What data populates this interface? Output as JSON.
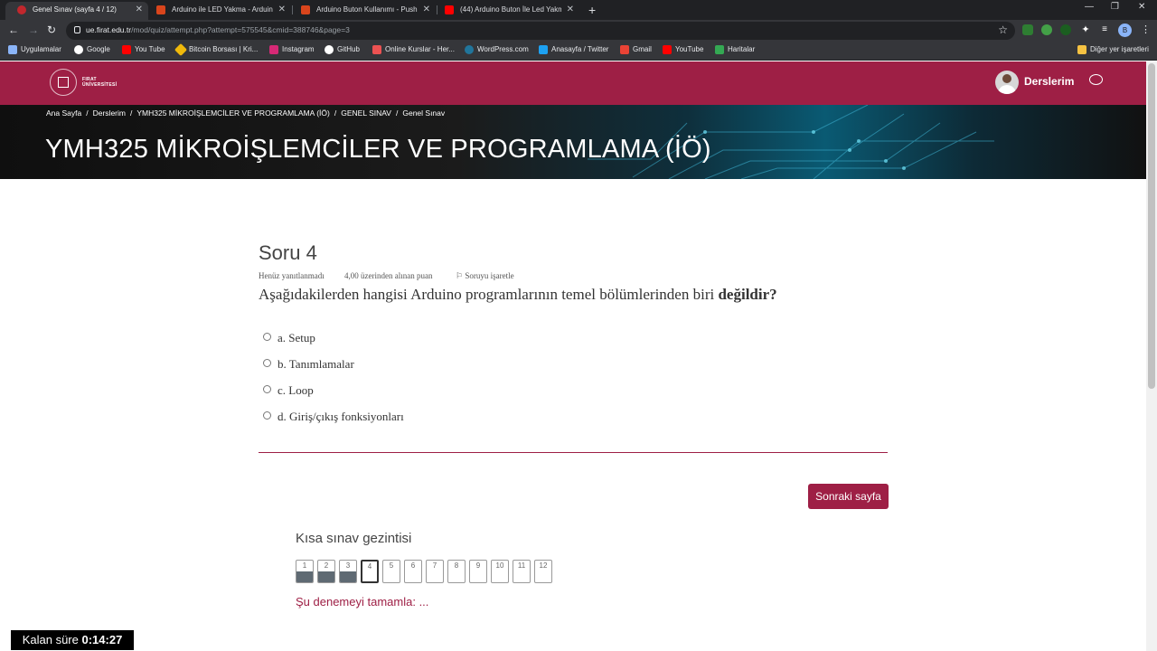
{
  "browser": {
    "tabs": [
      {
        "title": "Genel Sınav (sayfa 4 / 12)",
        "favicon_color": "#c1272d"
      },
      {
        "title": "Arduino ile LED Yakma - Arduino",
        "favicon_color": "#d9451c"
      },
      {
        "title": "Arduino Buton Kullanımı - Push B",
        "favicon_color": "#d9451c"
      },
      {
        "title": "(44) Arduino Buton İle Led Yakma",
        "favicon_color": "#ff0000"
      }
    ],
    "url_host": "ue.firat.edu.tr",
    "url_path": "/mod/quiz/attempt.php?attempt=575545&cmid=388746&page=3",
    "profile_initial": "B",
    "bookmarks": [
      {
        "label": "Uygulamalar",
        "color": "#8ab4f8"
      },
      {
        "label": "Google",
        "color": "#ea4335"
      },
      {
        "label": "You Tube",
        "color": "#ff0000"
      },
      {
        "label": "Bitcoin Borsası | Kri...",
        "color": "#f0b90b"
      },
      {
        "label": "Instagram",
        "color": "#d62976"
      },
      {
        "label": "GitHub",
        "color": "#ffffff"
      },
      {
        "label": "Online Kurslar - Her...",
        "color": "#ec5252"
      },
      {
        "label": "WordPress.com",
        "color": "#21759b"
      },
      {
        "label": "Anasayfa / Twitter",
        "color": "#1da1f2"
      },
      {
        "label": "Gmail",
        "color": "#ea4335"
      },
      {
        "label": "YouTube",
        "color": "#ff0000"
      },
      {
        "label": "Haritalar",
        "color": "#34a853"
      }
    ],
    "other_bookmarks": "Diğer yer işaretleri"
  },
  "site": {
    "logo_text_line1": "FIRAT",
    "logo_text_line2": "ÜNİVERSİTESİ",
    "brand_color": "#9e1f45",
    "user_menu_label": "Derslerim",
    "breadcrumb": [
      "Ana Sayfa",
      "Derslerim",
      "YMH325 MİKROİŞLEMCİLER VE PROGRAMLAMA (İÖ)",
      "GENEL SINAV",
      "Genel Sınav"
    ],
    "course_title": "YMH325 MİKROİŞLEMCİLER VE PROGRAMLAMA (İÖ)"
  },
  "question": {
    "number_label": "Soru 4",
    "status": "Henüz yanıtlanmadı",
    "points": "4,00 üzerinden alınan puan",
    "flag_label": "Soruyu işaretle",
    "text": "Aşağıdakilerden hangisi Arduino programlarının temel bölümlerinden biri",
    "text_bold": "değildir?",
    "answers": [
      "a. Setup",
      "b. Tanımlamalar",
      "c. Loop",
      "d. Giriş/çıkış fonksiyonları"
    ]
  },
  "next_button": "Sonraki sayfa",
  "quiz_nav": {
    "title": "Kısa sınav gezintisi",
    "pages": [
      {
        "label": "1",
        "state": "answered"
      },
      {
        "label": "2",
        "state": "answered"
      },
      {
        "label": "3",
        "state": "answered"
      },
      {
        "label": "4",
        "state": "current"
      },
      {
        "label": "5",
        "state": "empty"
      },
      {
        "label": "6",
        "state": "empty"
      },
      {
        "label": "7",
        "state": "empty"
      },
      {
        "label": "8",
        "state": "empty"
      },
      {
        "label": "9",
        "state": "empty"
      },
      {
        "label": "10",
        "state": "empty"
      },
      {
        "label": "11",
        "state": "empty"
      },
      {
        "label": "12",
        "state": "empty"
      }
    ],
    "finish_link": "Şu denemeyi tamamla: ..."
  },
  "timer": {
    "label": "Kalan süre",
    "value": "0:14:27"
  }
}
